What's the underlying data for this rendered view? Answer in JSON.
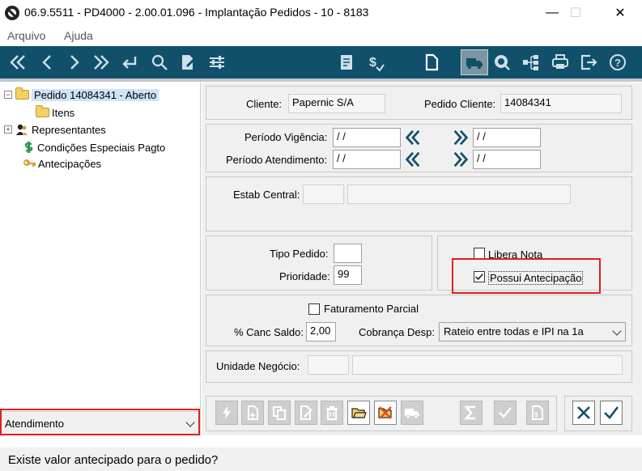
{
  "window": {
    "title": "06.9.5511 - PD4000 - 2.00.01.096 - Implantação Pedidos - 10 - 8183",
    "minimize": "—",
    "maximize": "☐",
    "close": "✕"
  },
  "menu": {
    "items": [
      "Arquivo",
      "Ajuda"
    ]
  },
  "toolbar": {
    "icons": [
      "first-icon",
      "previous-icon",
      "next-icon",
      "last-icon",
      "return-icon",
      "search-icon",
      "edit-document-icon",
      "filter-icon",
      "report-icon",
      "currency-icon",
      "new-document-icon",
      "delivery-truck-icon",
      "refresh-search-icon",
      "tree-icon",
      "print-icon",
      "exit-icon",
      "help-icon"
    ],
    "bg_color": "#10506b"
  },
  "tree": {
    "items": [
      {
        "label": "Pedido 14084341 - Aberto",
        "expander": "⊟"
      },
      {
        "label": "Itens"
      },
      {
        "label": "Representantes",
        "expander": "⊞"
      },
      {
        "label": "Condições Especiais Pagto"
      },
      {
        "label": "Antecipações"
      }
    ],
    "dropdown_value": "Atendimento"
  },
  "header": {
    "cliente_label": "Cliente:",
    "cliente_value": "Papernic S/A",
    "pedido_cliente_label": "Pedido Cliente:",
    "pedido_cliente_value": "14084341"
  },
  "periods": {
    "vigencia_label": "Período Vigência:",
    "vigencia_start": "/ /",
    "vigencia_end": "/ /",
    "atendimento_label": "Período Atendimento:",
    "atendimento_start": "/ /",
    "atendimento_end": "/ /"
  },
  "estab": {
    "label": "Estab Central:"
  },
  "pedido": {
    "tipo_label": "Tipo Pedido:",
    "tipo_value": "",
    "prioridade_label": "Prioridade:",
    "prioridade_value": "99",
    "libera_nota_label": "Libera Nota",
    "libera_nota_checked": false,
    "possui_antecipacao_label": "Possui Antecipação",
    "possui_antecipacao_checked": true
  },
  "faturamento": {
    "parcial_label": "Faturamento Parcial",
    "parcial_checked": false,
    "canc_saldo_label": "% Canc Saldo:",
    "canc_saldo_value": "2,00",
    "cobranca_label": "Cobrança Desp:",
    "cobranca_value": "Rateio entre todas e IPI na 1a"
  },
  "unidade": {
    "label": "Unidade Negócio:"
  },
  "actions": {
    "icons": [
      "lightning-icon",
      "new-file-icon",
      "copy-icon",
      "edit-file-icon",
      "trash-icon",
      "open-folder-icon",
      "cancel-folder-icon",
      "truck-icon",
      "sum-icon",
      "check-disabled-icon",
      "document-icon",
      "cancel-icon",
      "confirm-icon"
    ]
  },
  "status": {
    "message": "Existe valor antecipado para o pedido?"
  },
  "colors": {
    "highlight_red": "#e02020",
    "accent_blue": "#10506b"
  }
}
